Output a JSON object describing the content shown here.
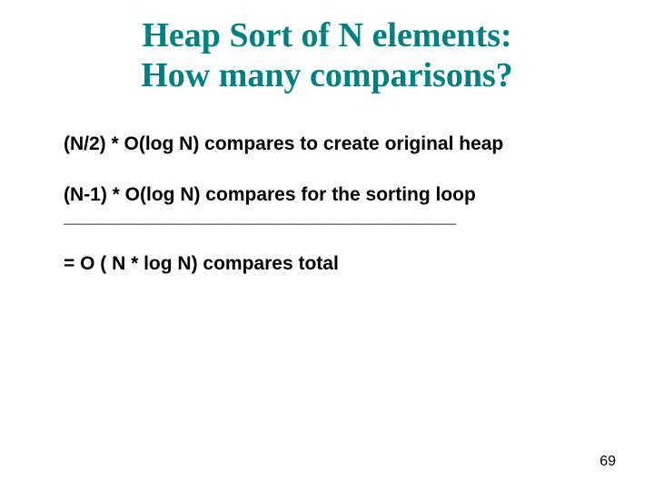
{
  "title_line1": "Heap Sort of N elements:",
  "title_line2": "How many comparisons?",
  "body": {
    "line1": "(N/2) * O(log N) compares to create original heap",
    "line2": "(N-1) * O(log N) compares for the sorting loop",
    "divider": "_____________________________________",
    "line3": "=  O ( N * log N) compares total"
  },
  "page_number": "69"
}
